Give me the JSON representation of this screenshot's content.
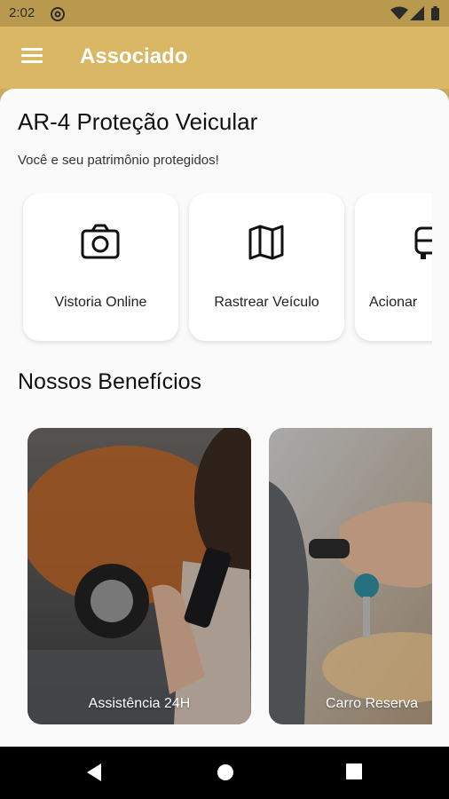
{
  "status_bar": {
    "time": "2:02",
    "icons": [
      "at-sign-icon",
      "wifi-icon",
      "signal-icon",
      "battery-icon"
    ]
  },
  "app_bar": {
    "title": "Associado",
    "menu_icon": "hamburger-menu-icon"
  },
  "main": {
    "heading": "AR-4 Proteção Veicular",
    "subheading": "Você e seu patrimônio protegidos!",
    "actions": [
      {
        "label": "Vistoria Online",
        "icon": "camera-icon"
      },
      {
        "label": "Rastrear Veículo",
        "icon": "map-icon"
      },
      {
        "label": "Acionar",
        "icon": "car-icon"
      }
    ],
    "benefits_title": "Nossos Benefícios",
    "benefits": [
      {
        "label": "Assistência 24H"
      },
      {
        "label": "Carro Reserva"
      }
    ]
  },
  "nav_bar": {
    "icons": [
      "back-icon",
      "home-icon",
      "recents-icon"
    ]
  },
  "colors": {
    "app_bar": "#d9b764",
    "status_bar": "#b9994e",
    "sheet": "#fafafa"
  }
}
